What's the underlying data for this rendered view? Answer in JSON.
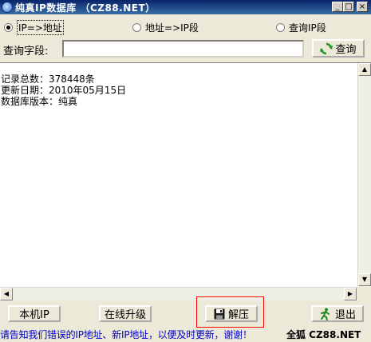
{
  "window": {
    "title": "纯真IP数据库 （CZ88.NET）",
    "buttons": {
      "minimize": "_",
      "maximize": "□",
      "close": "×"
    }
  },
  "search_modes": [
    {
      "label": "IP=>地址",
      "selected": true
    },
    {
      "label": "地址=>IP段",
      "selected": false
    },
    {
      "label": "查询IP段",
      "selected": false
    }
  ],
  "query": {
    "label": "查询字段:",
    "value": "",
    "button_label": "查询"
  },
  "output": {
    "lines": [
      "记录总数：378448条",
      "更新日期：2010年05月15日",
      "数据库版本：纯真"
    ]
  },
  "buttons": {
    "local_ip": "本机IP",
    "online_upgrade": "在线升级",
    "extract": "解压",
    "exit": "退出"
  },
  "status": {
    "message": "请告知我们错误的IP地址、新IP地址，以便及时更新，谢谢！",
    "brand": "全狐 CZ88.NET"
  },
  "colors": {
    "titlebar": "#0a246a",
    "status_text": "#0000c8",
    "highlight": "#ff0000"
  },
  "icons": {
    "app": "globe-icon",
    "query": "refresh-icon",
    "extract": "floppy-disk-icon",
    "exit": "running-man-icon"
  }
}
